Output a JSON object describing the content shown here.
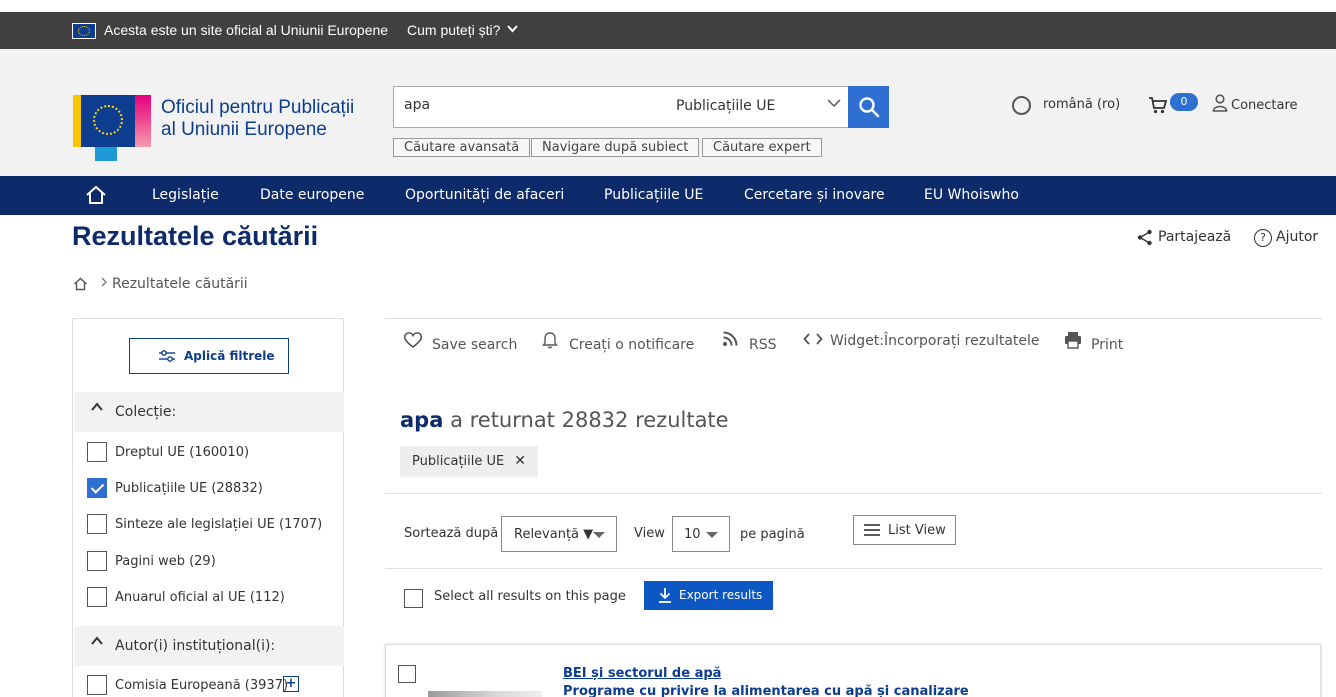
{
  "banner": {
    "text": "Acesta este un site oficial al Uniunii Europene",
    "link": "Cum puteți ști?"
  },
  "header": {
    "logo_line1": "Oficiul pentru Publicații",
    "logo_line2": "al Uniunii Europene",
    "search": {
      "value": "apa",
      "scope": "Publicațiile UE"
    },
    "sub_links": [
      "Căutare avansată",
      "Navigare după subiect",
      "Căutare expert"
    ],
    "language": "română (ro)",
    "cart_count": "0",
    "login": "Conectare"
  },
  "nav": {
    "items": [
      "Legislație",
      "Date europene",
      "Oportunități de afaceri",
      "Publicațiile UE",
      "Cercetare și inovare",
      "EU Whoiswho"
    ]
  },
  "page": {
    "title": "Rezultatele căutării",
    "share": "Partajează",
    "help": "Ajutor",
    "breadcrumb": "Rezultatele căutării"
  },
  "filters": {
    "apply": "Aplică filtrele",
    "collection_head": "Colecție:",
    "collection": [
      {
        "label": "Dreptul UE (160010)",
        "checked": false
      },
      {
        "label": "Publicațiile UE (28832)",
        "checked": true
      },
      {
        "label": "Sinteze ale legislației UE (1707)",
        "checked": false
      },
      {
        "label": "Pagini web (29)",
        "checked": false
      },
      {
        "label": "Anuarul oficial al UE (112)",
        "checked": false
      }
    ],
    "author_head": "Autor(i) instituțional(i):",
    "authors": [
      {
        "label": "Comisia Europeană (3937)",
        "checked": false
      }
    ]
  },
  "toolbar": {
    "save": "Save search",
    "notify": "Creați o notificare",
    "rss": "RSS",
    "widget": "Widget:Încorporați rezultatele",
    "print": "Print"
  },
  "results": {
    "query": "apa",
    "summary": "a returnat 28832 rezultate",
    "chip": "Publicațiile UE",
    "sort_label": "Sortează după",
    "sort_value": "Relevanță ▼",
    "view_label": "View",
    "view_value": "10",
    "per_page": "pe pagină",
    "list_view": "List View",
    "select_all": "Select all results on this page",
    "export": "Export results",
    "first": {
      "title_prefix": "BEI și sectorul de ",
      "title_term": "apă",
      "sub_prefix": "Programe cu privire la alimentarea cu ",
      "sub_term": "apă",
      "sub_suffix": " și canalizare"
    }
  },
  "colors": {
    "banner_bg": "#404040",
    "header_bg": "#f2f2f2",
    "nav_bg": "#0d2a6b",
    "primary": "#2e6fd1",
    "title": "#0d2a6b"
  }
}
